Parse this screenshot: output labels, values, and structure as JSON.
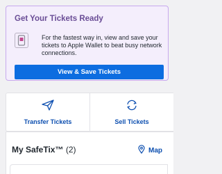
{
  "promo": {
    "title": "Get Your Tickets Ready",
    "body": "For the fastest way in, view and save your tickets to Apple Wallet to beat busy network connections.",
    "button_label": "View & Save Tickets",
    "icon": "phone-ticket-icon"
  },
  "actions": {
    "transfer": {
      "label": "Transfer Tickets",
      "icon": "paper-plane-icon"
    },
    "sell": {
      "label": "Sell Tickets",
      "icon": "refresh-arrows-icon"
    }
  },
  "my_tickets": {
    "title": "My SafeTix™",
    "count": "(2)",
    "map_label": "Map",
    "map_icon": "map-pin-icon"
  },
  "colors": {
    "accent": "#0d6de0",
    "promo_bg": "#f4eefc",
    "promo_border": "#c7a9ee",
    "promo_title": "#6a4d96",
    "link": "#0d4fb0"
  }
}
